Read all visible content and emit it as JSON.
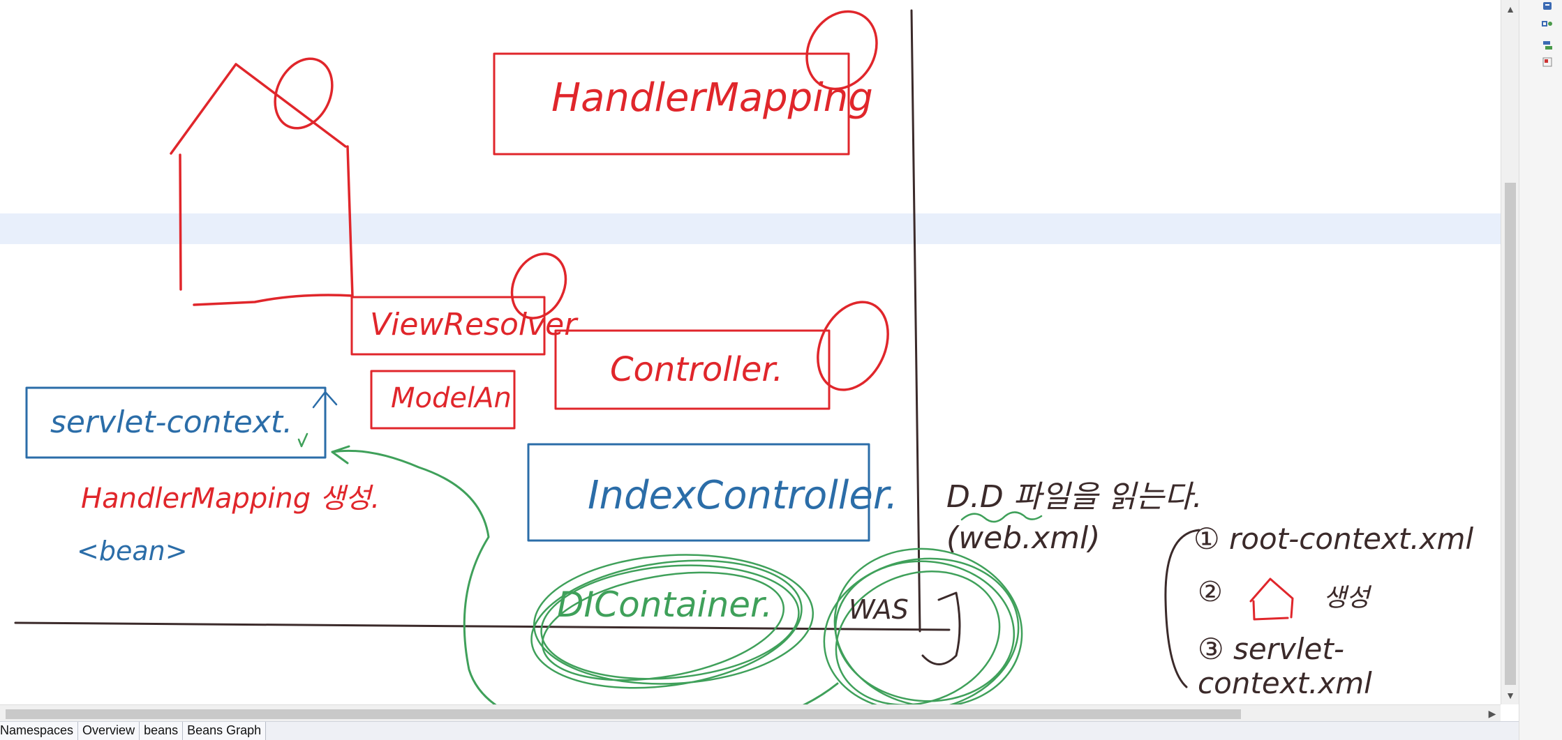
{
  "colors": {
    "red": "#e0262b",
    "blue": "#2b6da8",
    "green": "#3fa05a",
    "dark": "#3b2a2a"
  },
  "drawing": {
    "boxes": {
      "handler_mapping": "HandlerMapping",
      "view_resolver": "ViewResolver",
      "model": "ModelAn",
      "controller": "Controller.",
      "servlet_context": "servlet-context.",
      "index_controller": "IndexController.",
      "di_container": "DIContainer."
    },
    "notes": {
      "handler_mapping_note": "HandlerMapping 생성.",
      "bean_tag": "<bean>",
      "was_label": "WAS",
      "dd_line1": "D.D 파일을 읽는다.",
      "dd_line2": "(web.xml)",
      "list_item1": "① root-context.xml",
      "list_item2_num": "②",
      "list_item2_text": "생성",
      "list_item3": "③ servlet-context.xml"
    }
  },
  "tabs": [
    "Namespaces",
    "Overview",
    "beans",
    "Beans Graph"
  ],
  "icons": [
    "pen-tool-icon",
    "shapes-tool-icon",
    "layers-tool-icon",
    "eraser-tool-icon",
    "scroll-up-icon",
    "scroll-down-icon",
    "scroll-right-icon"
  ]
}
